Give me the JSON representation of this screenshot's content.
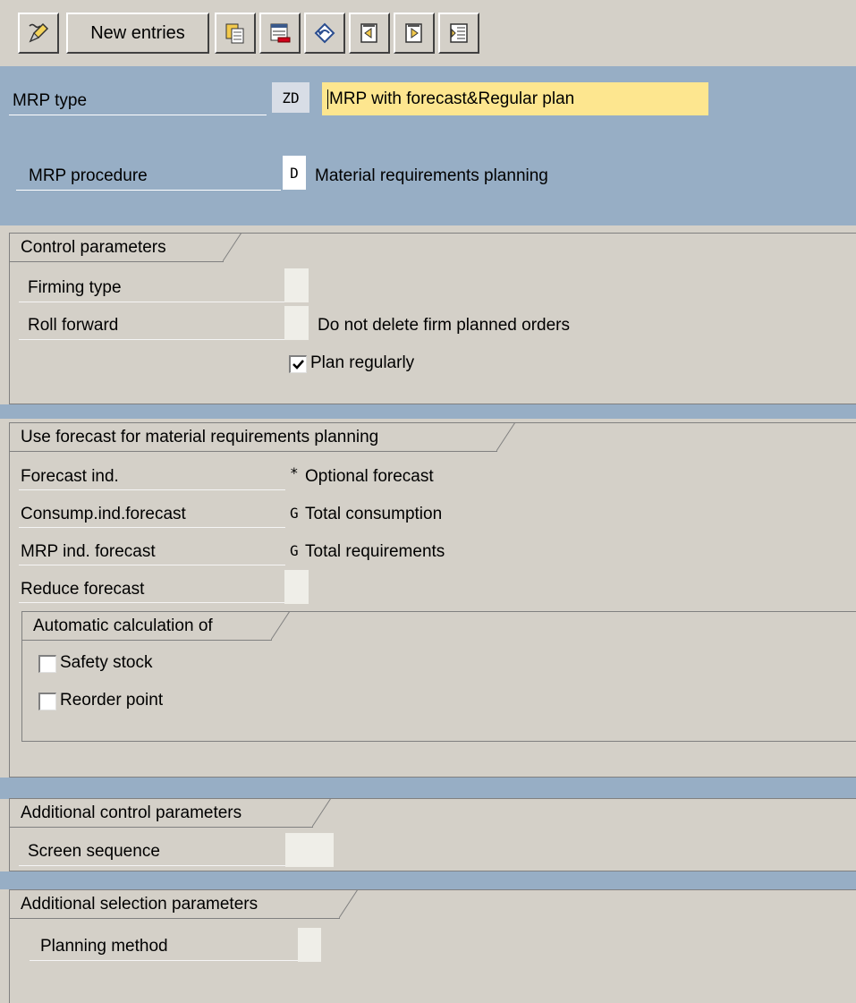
{
  "toolbar": {
    "buttons": [
      {
        "name": "display-change-icon"
      },
      {
        "label": "New entries"
      },
      {
        "name": "copy-as-icon"
      },
      {
        "name": "delete-icon"
      },
      {
        "name": "undo-change-icon"
      },
      {
        "name": "previous-entry-icon"
      },
      {
        "name": "next-entry-icon"
      },
      {
        "name": "select-all-icon"
      }
    ]
  },
  "header": {
    "mrp_type_label": "MRP type",
    "mrp_type_code": "ZD",
    "mrp_type_desc": "MRP with forecast&Regular plan",
    "mrp_procedure_label": "MRP procedure",
    "mrp_procedure_code": "D",
    "mrp_procedure_desc": "Material requirements planning"
  },
  "control_parameters": {
    "title": "Control parameters",
    "firming_type_label": "Firming type",
    "firming_type_value": "",
    "roll_forward_label": "Roll forward",
    "roll_forward_value": "",
    "roll_forward_desc": "Do not delete firm planned orders",
    "plan_regularly_label": "Plan regularly",
    "plan_regularly_checked": true
  },
  "forecast": {
    "title": "Use forecast for material requirements planning",
    "forecast_ind_label": "Forecast ind.",
    "forecast_ind_code": "*",
    "forecast_ind_desc": "Optional forecast",
    "consump_label": "Consump.ind.forecast",
    "consump_code": "G",
    "consump_desc": "Total consumption",
    "mrp_ind_label": "MRP ind. forecast",
    "mrp_ind_code": "G",
    "mrp_ind_desc": "Total requirements",
    "reduce_label": "Reduce forecast",
    "reduce_value": "",
    "auto_calc": {
      "title": "Automatic calculation of",
      "safety_stock_label": "Safety stock",
      "safety_stock_checked": false,
      "reorder_point_label": "Reorder point",
      "reorder_point_checked": false
    }
  },
  "additional_control": {
    "title": "Additional control parameters",
    "screen_sequence_label": "Screen sequence",
    "screen_sequence_value": ""
  },
  "additional_selection": {
    "title": "Additional selection parameters",
    "planning_method_label": "Planning method",
    "planning_method_value": ""
  },
  "colors": {
    "header_band": "#97aec5",
    "panel": "#d4d0c8",
    "highlight_field": "#fde68f"
  }
}
